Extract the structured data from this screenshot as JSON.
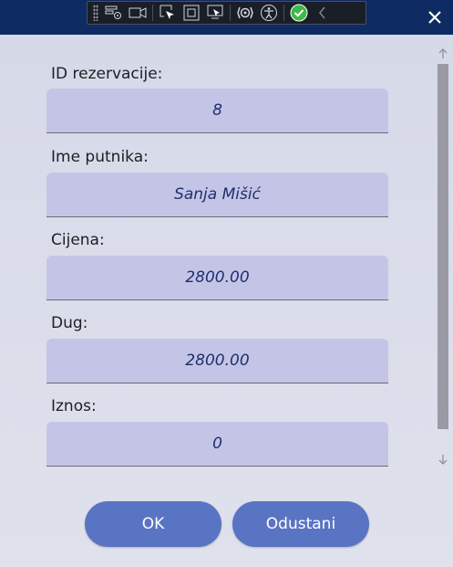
{
  "fields": [
    {
      "label": "ID rezervacije:",
      "value": "8"
    },
    {
      "label": "Ime putnika:",
      "value": "Sanja Mišić"
    },
    {
      "label": "Cijena:",
      "value": "2800.00"
    },
    {
      "label": "Dug:",
      "value": "2800.00"
    },
    {
      "label": "Iznos:",
      "value": "0"
    }
  ],
  "buttons": {
    "ok": "OK",
    "cancel": "Odustani"
  },
  "icons": [
    "select-element-icon",
    "video-icon",
    "pointer-select-icon",
    "layout-bounds-icon",
    "screen-select-icon",
    "hot-reload-icon",
    "accessibility-icon",
    "check-icon",
    "collapse-icon",
    "close-icon"
  ],
  "colors": {
    "titlebar": "#0f2b63",
    "button": "#5a74c4",
    "field": "#c4c5e6",
    "check": "#3fb84a"
  }
}
